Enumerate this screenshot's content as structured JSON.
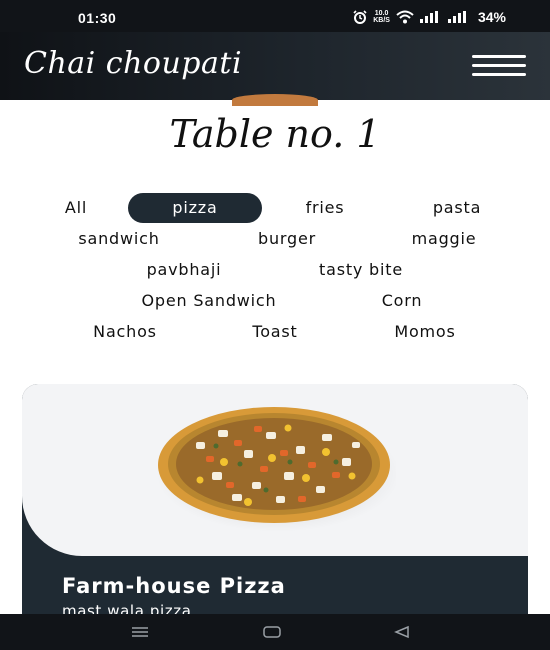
{
  "status_bar": {
    "time": "01:30",
    "net_speed_value": "10.0",
    "net_speed_unit": "KB/S",
    "battery": "34%",
    "icons": [
      "alarm-icon",
      "wifi-icon",
      "signal-icon",
      "signal-icon"
    ]
  },
  "header": {
    "brand": "Chai choupati",
    "menu_icon": "hamburger-menu-icon"
  },
  "table_title": "Table no. 1",
  "categories": [
    {
      "label": "All",
      "active": false
    },
    {
      "label": "pizza",
      "active": true
    },
    {
      "label": "fries",
      "active": false
    },
    {
      "label": "pasta",
      "active": false
    },
    {
      "label": "sandwich",
      "active": false
    },
    {
      "label": "burger",
      "active": false
    },
    {
      "label": "maggie",
      "active": false
    },
    {
      "label": "pavbhaji",
      "active": false
    },
    {
      "label": "tasty bite",
      "active": false
    },
    {
      "label": "Open Sandwich",
      "active": false
    },
    {
      "label": "Corn",
      "active": false
    },
    {
      "label": "Nachos",
      "active": false
    },
    {
      "label": "Toast",
      "active": false
    },
    {
      "label": "Momos",
      "active": false
    }
  ],
  "card": {
    "title": "Farm-house Pizza",
    "subtitle": "mast wala pizza",
    "image": "pizza-image"
  },
  "nav_bar": {
    "icons": [
      "recent-apps-icon",
      "home-icon",
      "back-icon"
    ]
  },
  "colors": {
    "header_bg": "#1e252c",
    "chip_active_bg": "#1f2a33",
    "card_bg": "#1f2a33",
    "card_image_bg": "#f3f4f6"
  }
}
